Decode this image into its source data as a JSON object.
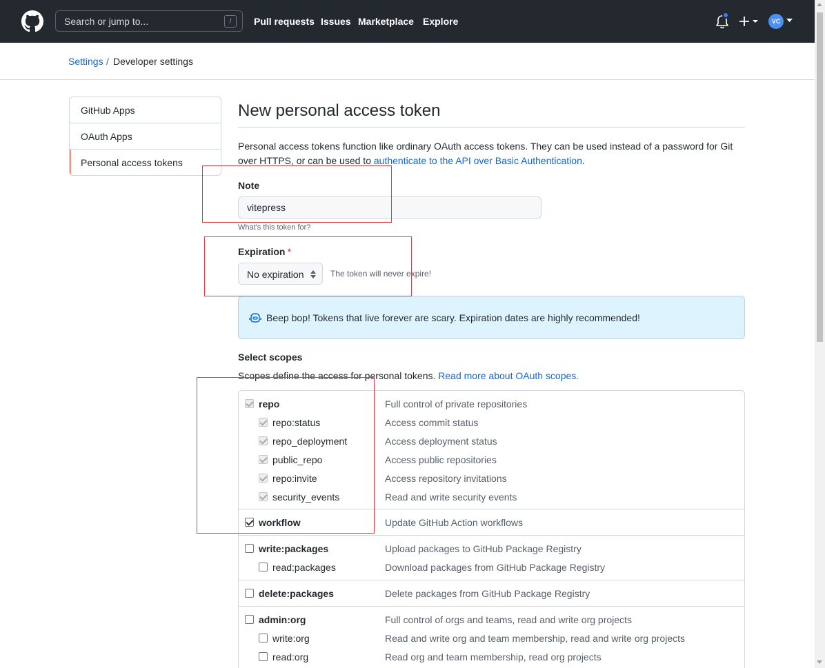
{
  "header": {
    "search_placeholder": "Search or jump to...",
    "slash_key": "/",
    "nav": [
      "Pull requests",
      "Issues",
      "Marketplace",
      "Explore"
    ],
    "avatar_initials": "VC"
  },
  "breadcrumb": {
    "parent": "Settings",
    "separator": "/",
    "current": "Developer settings"
  },
  "sidebar": {
    "items": [
      {
        "label": "GitHub Apps"
      },
      {
        "label": "OAuth Apps"
      },
      {
        "label": "Personal access tokens"
      }
    ]
  },
  "main": {
    "title": "New personal access token",
    "intro_text": "Personal access tokens function like ordinary OAuth access tokens. They can be used instead of a password for Git over HTTPS, or can be used to ",
    "intro_link": "authenticate to the API over Basic Authentication",
    "intro_end": ".",
    "note_label": "Note",
    "note_value": "vitepress",
    "note_hint": "What's this token for?",
    "expiration_label": "Expiration",
    "expiration_required": "*",
    "expiration_value": "No expiration",
    "expiration_hint": "The token will never expire!",
    "flash_text": "Beep bop! Tokens that live forever are scary. Expiration dates are highly recommended!",
    "scopes_label": "Select scopes",
    "scopes_desc": "Scopes define the access for personal tokens. ",
    "scopes_link": "Read more about OAuth scopes.",
    "scopes": [
      {
        "name": "repo",
        "desc": "Full control of private repositories"
      },
      {
        "name": "repo:status",
        "desc": "Access commit status"
      },
      {
        "name": "repo_deployment",
        "desc": "Access deployment status"
      },
      {
        "name": "public_repo",
        "desc": "Access public repositories"
      },
      {
        "name": "repo:invite",
        "desc": "Access repository invitations"
      },
      {
        "name": "security_events",
        "desc": "Read and write security events"
      },
      {
        "name": "workflow",
        "desc": "Update GitHub Action workflows"
      },
      {
        "name": "write:packages",
        "desc": "Upload packages to GitHub Package Registry"
      },
      {
        "name": "read:packages",
        "desc": "Download packages from GitHub Package Registry"
      },
      {
        "name": "delete:packages",
        "desc": "Delete packages from GitHub Package Registry"
      },
      {
        "name": "admin:org",
        "desc": "Full control of orgs and teams, read and write org projects"
      },
      {
        "name": "write:org",
        "desc": "Read and write org and team membership, read and write org projects"
      },
      {
        "name": "read:org",
        "desc": "Read org and team membership, read org projects"
      }
    ]
  },
  "colors": {
    "header_bg": "#24292f",
    "link": "#0969da",
    "active_indicator": "#fd8c73",
    "flash_bg": "#ddf4ff",
    "annotation": "#e0383e"
  }
}
